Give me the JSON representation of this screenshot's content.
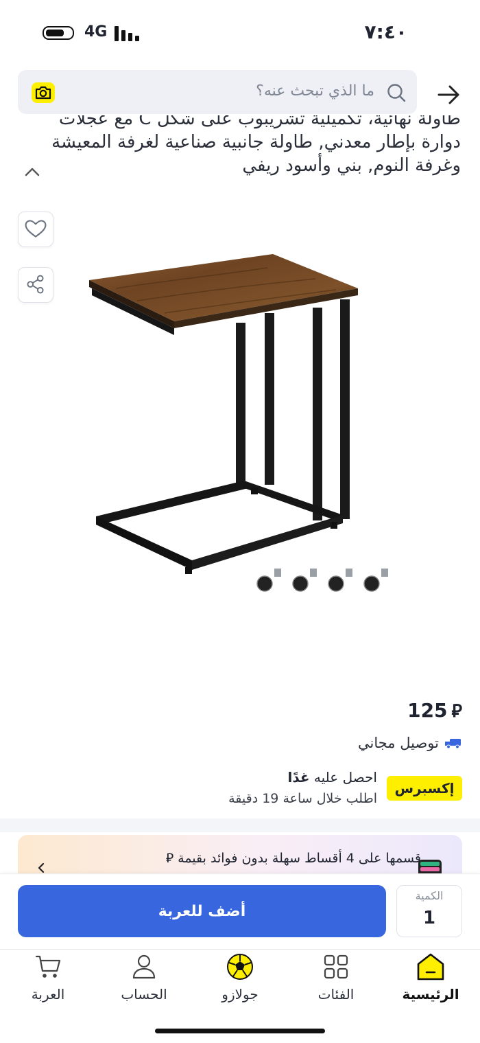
{
  "status_bar": {
    "time": "٧:٤٠",
    "network": "4G"
  },
  "header": {
    "search_placeholder": "ما الذي تبحث عنه؟",
    "icons": [
      "camera-icon",
      "search-icon",
      "back-arrow-icon"
    ]
  },
  "product": {
    "title": "طاولة نهائية، تكميلية تشريبوب على شكل C مع عجلات دوارة بإطار معدني, طاولة جانبية صناعية لغرفة المعيشة وغرفة النوم, بني وأسود ريفي",
    "price": "125",
    "currency_symbol": "⃁",
    "delivery_label": "توصيل مجاني",
    "express_badge": "إكسبرس",
    "express_get_it": "احصل عليه",
    "express_day": "غدًا",
    "express_order_within": "اطلب خلال ساعة 19 دقيقة",
    "installment_text": "قسمها على 4 أقساط سهلة بدون فوائد بقيمة ⃁"
  },
  "action_bar": {
    "add_to_cart_label": "أضف للعربة",
    "quantity_label": "الكمية",
    "quantity_value": "1"
  },
  "bottom_nav": {
    "items": [
      {
        "label": "الرئيسية",
        "icon": "home-icon"
      },
      {
        "label": "الفئات",
        "icon": "grid-icon"
      },
      {
        "label": "جولازو",
        "icon": "soccer-ball-icon"
      },
      {
        "label": "الحساب",
        "icon": "user-icon"
      },
      {
        "label": "العربة",
        "icon": "cart-icon"
      }
    ]
  },
  "colors": {
    "accent_blue": "#3866df",
    "brand_yellow": "#feee00",
    "search_bg": "#eef0f5"
  }
}
